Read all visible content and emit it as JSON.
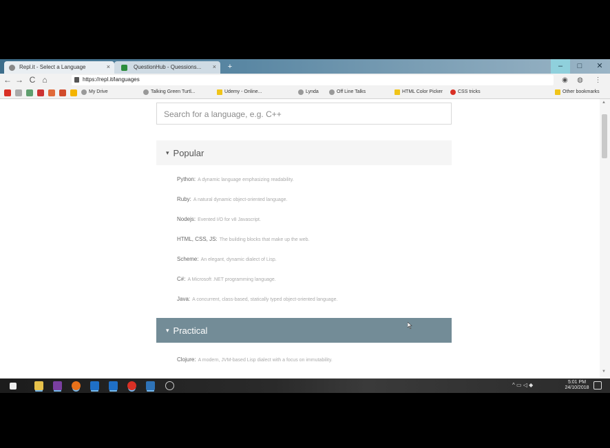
{
  "browser": {
    "tabs": [
      {
        "title": "Repl.it - Select a Language"
      },
      {
        "title": "QuestionHub - Quessions..."
      }
    ],
    "new_tab": "+",
    "window_controls": {
      "minimize": "–",
      "maximize": "□",
      "close": "✕"
    },
    "nav": {
      "back": "←",
      "forward": "→",
      "reload": "C",
      "home": "⌂"
    },
    "url": "https://repl.it/languages",
    "bookmarks": [
      {
        "label": "My Drive"
      },
      {
        "label": "Talking Green Turtl..."
      },
      {
        "label": "Udemy - Online..."
      },
      {
        "label": "Lynda"
      },
      {
        "label": "Off Line Talks"
      },
      {
        "label": "HTML Color Picker"
      },
      {
        "label": "CSS tricks"
      }
    ],
    "other_bookmarks": "Other bookmarks"
  },
  "page": {
    "search": {
      "placeholder": "Search for a language, e.g. C++"
    },
    "sections": {
      "popular": {
        "caret": "▾",
        "title": "Popular"
      },
      "practical": {
        "caret": "▾",
        "title": "Practical"
      }
    },
    "popular_languages": [
      {
        "name": "Python:",
        "description": "A dynamic language emphasizing readability."
      },
      {
        "name": "Ruby:",
        "description": "A natural dynamic object-oriented language."
      },
      {
        "name": "Nodejs:",
        "description": "Evented I/O for v8 Javascript."
      },
      {
        "name": "HTML, CSS, JS:",
        "description": "The building blocks that make up the web."
      },
      {
        "name": "Scheme:",
        "description": "An elegant, dynamic dialect of Lisp."
      },
      {
        "name": "C#:",
        "description": "A Microsoft .NET programming language."
      },
      {
        "name": "Java:",
        "description": "A concurrent, class-based, statically typed object-oriented language."
      }
    ],
    "practical_languages": [
      {
        "name": "Clojure:",
        "description": "A modern, JVM-based Lisp dialect with a focus on immutability."
      }
    ]
  },
  "taskbar": {
    "tray_icons": "^ ▭ ◁ ◆",
    "time": "5:01 PM",
    "date": "24/10/2018"
  },
  "colors": {
    "practical_header": "#738c97",
    "popular_header": "#f5f5f5",
    "tabstrip": "#5a87a3"
  }
}
